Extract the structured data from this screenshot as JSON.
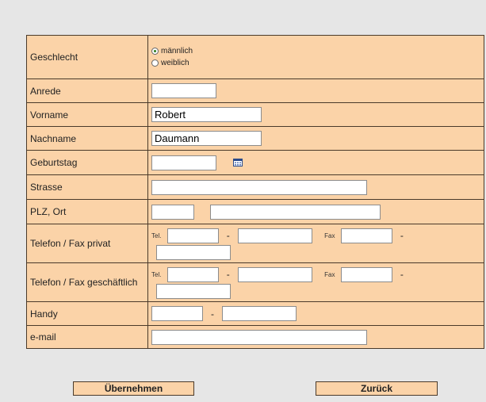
{
  "form": {
    "gender": {
      "label": "Geschlecht",
      "options": [
        {
          "label": "männlich",
          "checked": true
        },
        {
          "label": "weiblich",
          "checked": false
        }
      ]
    },
    "salutation": {
      "label": "Anrede",
      "value": ""
    },
    "firstname": {
      "label": "Vorname",
      "value": "Robert"
    },
    "lastname": {
      "label": "Nachname",
      "value": "Daumann"
    },
    "birthday": {
      "label": "Geburtstag",
      "value": "",
      "icon": "calendar-icon"
    },
    "street": {
      "label": "Strasse",
      "value": ""
    },
    "zip_city": {
      "label": "PLZ, Ort",
      "zip": "",
      "city": ""
    },
    "phone_private": {
      "label": "Telefon / Fax privat",
      "tel_label": "Tel.",
      "fax_label": "Fax",
      "separator": "-",
      "tel_area": "",
      "tel_number": "",
      "fax_area": "",
      "fax_number": ""
    },
    "phone_business": {
      "label": "Telefon / Fax geschäftlich",
      "tel_label": "Tel.",
      "fax_label": "Fax",
      "separator": "-",
      "tel_area": "",
      "tel_number": "",
      "fax_area": "",
      "fax_number": ""
    },
    "mobile": {
      "label": "Handy",
      "separator": "-",
      "area": "",
      "number": ""
    },
    "email": {
      "label": "e-mail",
      "value": ""
    }
  },
  "buttons": {
    "submit": "Übernehmen",
    "back": "Zurück"
  },
  "colors": {
    "background": "#e6e6e6",
    "form_bg": "#fbd3a8",
    "border": "#4a3a2a"
  }
}
